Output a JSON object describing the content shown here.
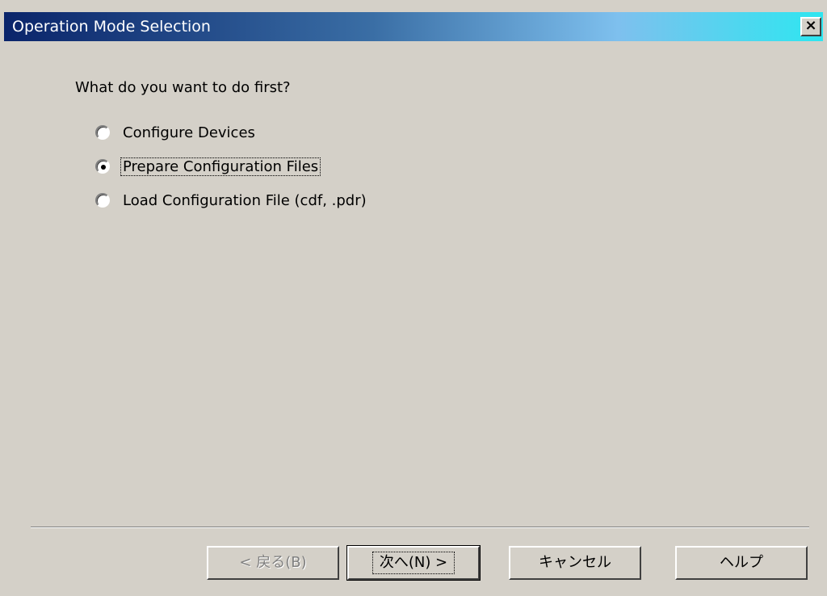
{
  "window": {
    "title": "Operation Mode Selection",
    "close_glyph": "×"
  },
  "prompt": "What do you want to do first?",
  "options": [
    {
      "label": "Configure Devices",
      "selected": false
    },
    {
      "label": "Prepare Configuration Files",
      "selected": true
    },
    {
      "label": "Load Configuration File (cdf, .pdr)",
      "selected": false
    }
  ],
  "buttons": {
    "back": "< 戻る(B)",
    "next": "次へ(N) >",
    "cancel": "キャンセル",
    "help": "ヘルプ"
  }
}
